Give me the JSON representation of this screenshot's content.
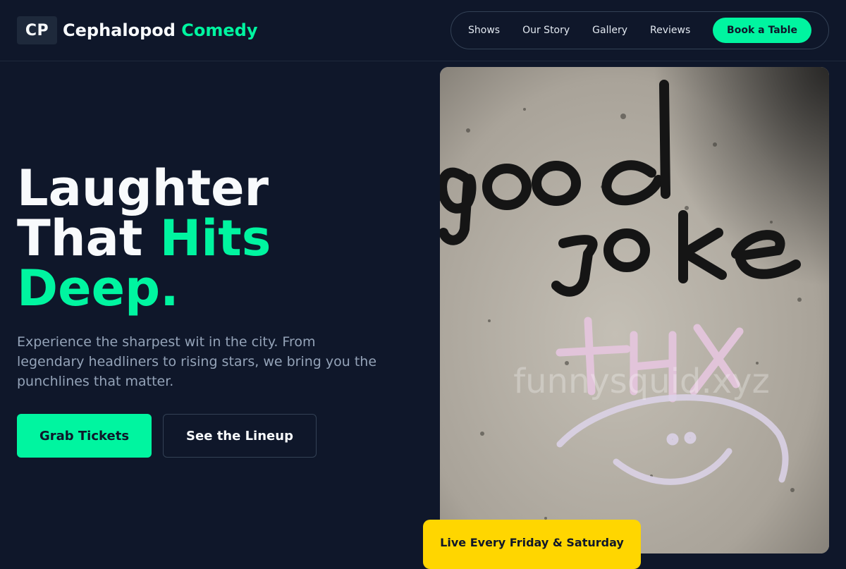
{
  "brand": {
    "mark": "CP",
    "name": "Cephalopod",
    "name_accent": "Comedy"
  },
  "nav": {
    "items": [
      {
        "label": "Shows"
      },
      {
        "label": "Our Story"
      },
      {
        "label": "Gallery"
      },
      {
        "label": "Reviews"
      }
    ],
    "cta_label": "Book a Table"
  },
  "hero": {
    "title_line1": "Laughter",
    "title_line2_plain": "That ",
    "title_line2_accent": "Hits",
    "title_line3_accent": "Deep.",
    "subtitle": "Experience the sharpest wit in the city. From legendary headliners to rising stars, we bring you the punchlines that matter.",
    "primary_button": "Grab Tickets",
    "secondary_button": "See the Lineup"
  },
  "image": {
    "alt": "Wall graffiti reading good joke thx",
    "watermark": "funnysquid.xyz"
  },
  "badge": {
    "label": "Live Every Friday & Saturday"
  },
  "colors": {
    "background": "#0f172a",
    "accent": "#00f5a0",
    "badge": "#ffd600",
    "muted_text": "#94a3b8"
  }
}
